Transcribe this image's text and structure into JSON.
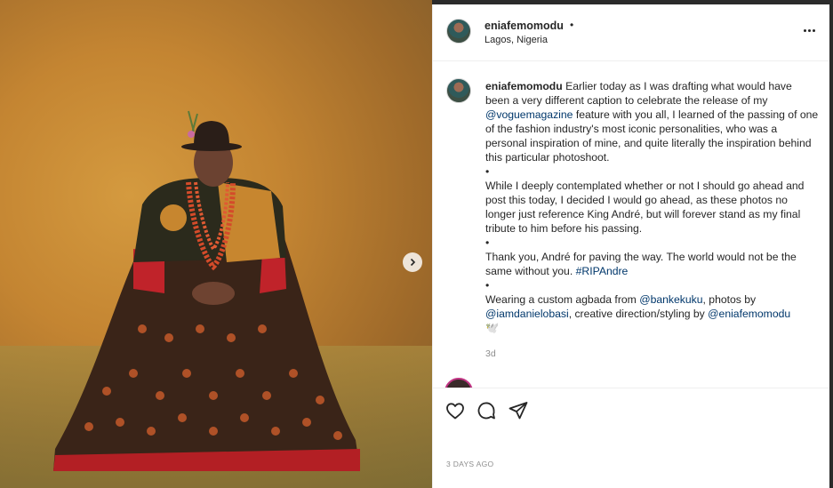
{
  "post": {
    "username": "eniafemomodu",
    "dot": "•",
    "location": "Lagos, Nigeria",
    "caption": {
      "username": "eniafemomodu",
      "text1": " Earlier today as I was drafting what would have been a very different caption to celebrate the release of my ",
      "mention1": "@voguemagazine",
      "text2": " feature with you all, I learned of the passing of one of the fashion industry's most iconic personalities, who was a personal inspiration of mine, and quite literally the inspiration behind this particular photoshoot.",
      "bullet": "•",
      "para2": "While I deeply contemplated whether or not I should go ahead and post this today, I decided I would go ahead, as these photos no longer just reference King André, but will forever stand as my final tribute to him before his passing.",
      "para3_text": "Thank you, André for paving the way. The world would not be the same without you. ",
      "hashtag": "#RIPAndre",
      "para4_text1": "Wearing a custom agbada from ",
      "mention2": "@bankekuku",
      "para4_text2": ", photos by ",
      "mention3": "@iamdanielobasi",
      "para4_text3": ", creative direction/styling by ",
      "mention4": "@eniafemomodu",
      "emoji": "🕊️"
    },
    "age": "3d",
    "timestamp": "3 DAYS AGO"
  },
  "icons": {
    "more": "more-options-icon",
    "like": "heart-icon",
    "comment": "comment-icon",
    "share": "share-icon",
    "next": "chevron-right-icon"
  },
  "colors": {
    "text": "#262626",
    "link": "#00376b",
    "muted": "#8e8e8e",
    "backdrop": "#c48532"
  }
}
